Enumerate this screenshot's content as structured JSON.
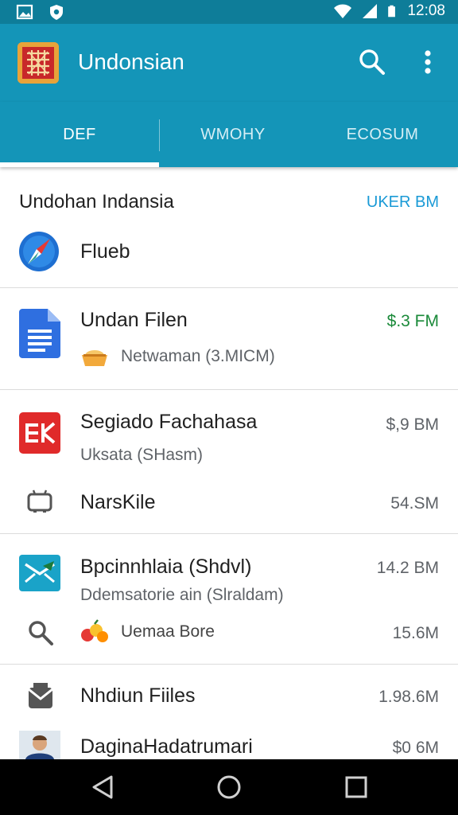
{
  "status_bar": {
    "time": "12:08",
    "icons": [
      "image-icon",
      "shield-icon",
      "wifi-icon",
      "signal-icon",
      "battery-icon"
    ]
  },
  "app_bar": {
    "title": "Undonsian",
    "icons": [
      "app-logo-icon",
      "search-icon",
      "more-vert-icon"
    ],
    "color": "#1495b8"
  },
  "tabs": [
    {
      "label": "DEF",
      "selected": true
    },
    {
      "label": "WMOHY",
      "selected": false
    },
    {
      "label": "ECOSUM",
      "selected": false
    }
  ],
  "header": {
    "title": "Undohan Indansia",
    "action": "UKER BM",
    "action_color": "#1a9ad6"
  },
  "items": [
    {
      "title": "Flueb",
      "icon": "compass-icon"
    },
    {
      "title": "Undan Filen",
      "size": "$.3 FM",
      "size_color": "#1b8a3a",
      "sub": "Netwaman (3.MICM)",
      "icon": "document-icon",
      "sub_icon": "food-icon"
    },
    {
      "title": "Segiado Fachahasa",
      "size": "$,9 BM",
      "sub": "Uksata (SHasm)",
      "icon": "bk-app-icon"
    },
    {
      "title": "NarsKile",
      "size": "54.SM",
      "icon": "tv-icon"
    },
    {
      "title": "Bpcinnhlaia (Shdvl)",
      "size": "14.2 BM",
      "sub": "Ddemsatorie ain (Slraldam)",
      "icon": "mail-app-icon"
    },
    {
      "title": "Uemaa Bore",
      "size": "15.6M",
      "icon": "search-icon",
      "sub_icon": "fruit-icon"
    },
    {
      "title": "Nhdiun Fiiles",
      "size": "1.98.6M",
      "icon": "inbox-icon"
    },
    {
      "title": "DaginaHadatrumari",
      "size": "$0 6M",
      "icon": "avatar-icon"
    }
  ],
  "nav_bar": {
    "icons": [
      "back-icon",
      "home-icon",
      "recents-icon"
    ]
  }
}
